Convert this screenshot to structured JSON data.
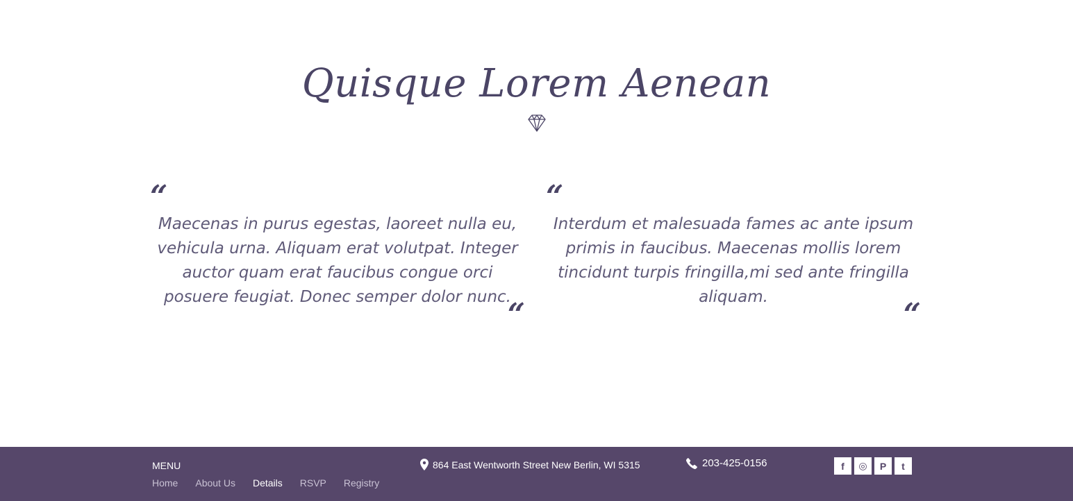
{
  "hero": {
    "title": "Quisque Lorem Aenean"
  },
  "quotes": [
    {
      "open_mark": "“",
      "text": "Maecenas in purus egestas, laoreet nulla eu, vehicula urna. Aliquam erat volutpat. Integer auctor quam erat faucibus congue orci posuere feugiat. Donec semper dolor nunc.",
      "close_mark": "“"
    },
    {
      "open_mark": "“",
      "text": "Interdum et malesuada fames ac ante ipsum primis in faucibus. Maecenas mollis lorem tincidunt  turpis fringilla,mi sed ante fringilla aliquam.",
      "close_mark": "“"
    }
  ],
  "footer": {
    "menu_title": "MENU",
    "menu_items": [
      {
        "label": "Home"
      },
      {
        "label": "About Us"
      },
      {
        "label": "Details"
      },
      {
        "label": "RSVP"
      },
      {
        "label": "Registry"
      }
    ],
    "active_menu_item": "Details",
    "address": "864 East Wentworth Street New Berlin, WI 5315",
    "phone": "203-425-0156",
    "social": [
      {
        "icon": "facebook-icon",
        "glyph": "f"
      },
      {
        "icon": "instagram-icon",
        "glyph": "◎"
      },
      {
        "icon": "pinterest-icon",
        "glyph": "P"
      },
      {
        "icon": "twitter-icon",
        "glyph": "t"
      }
    ],
    "background_color": "#56476a"
  },
  "colors": {
    "accent": "#4b4566",
    "text": "#5f5a78",
    "footer_bg": "#56476a"
  }
}
